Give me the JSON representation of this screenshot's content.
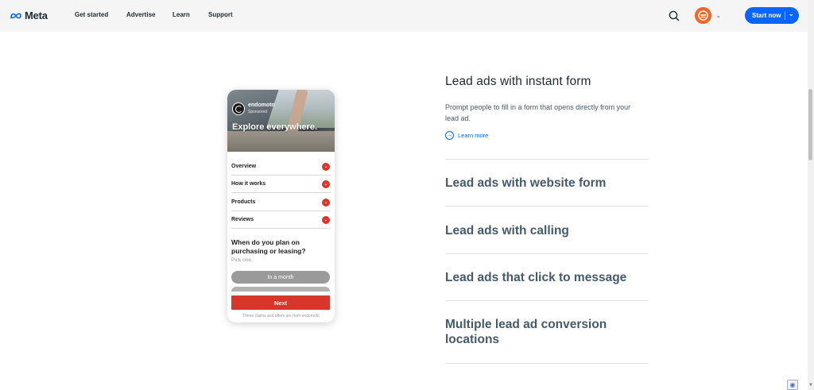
{
  "nav": {
    "logo_text": "Meta",
    "links": [
      "Get started",
      "Advertise",
      "Learn",
      "Support"
    ],
    "start_button": "Start now"
  },
  "phone": {
    "brand_name": "endomoto",
    "brand_sub": "Sponsored",
    "headline": "Explore everywhere.",
    "accordion": [
      "Overview",
      "How it works",
      "Products",
      "Reviews"
    ],
    "question": "When do you plan on purchasing or leasing?",
    "hint": "Pick one.",
    "option": "In a month",
    "next_button": "Next",
    "disclaimer": "These claims and offers are from endomoto"
  },
  "sections": {
    "active": {
      "title": "Lead ads with instant form",
      "description": "Prompt people to fill in a form that opens directly from your lead ad.",
      "learn_more": "Learn more"
    },
    "others": [
      "Lead ads with website form",
      "Lead ads with calling",
      "Lead ads that click to message",
      "Multiple lead ad conversion locations"
    ]
  },
  "colors": {
    "brand_blue": "#0866ff",
    "accent_red": "#d9362b",
    "avatar_orange": "#f0652a"
  }
}
